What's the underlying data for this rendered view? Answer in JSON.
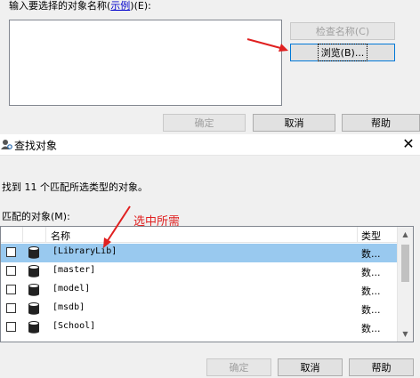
{
  "prev_dialog": {
    "prompt_label": "输入要选择的对象名称(",
    "example_link": "示例",
    "prompt_suffix": ")(E):",
    "check_names_button": "检查名称(C)",
    "browse_button": "浏览(B)...",
    "ok_button": "确定",
    "cancel_button": "取消",
    "help_button": "帮助"
  },
  "find_dialog": {
    "title": "查找对象",
    "found_text": "找到 11 个匹配所选类型的对象。",
    "matched_label": "匹配的对象(M):",
    "columns": {
      "name": "名称",
      "type": "类型"
    },
    "rows": [
      {
        "name": "[LibraryLib]",
        "type": "数...",
        "selected": true
      },
      {
        "name": "[master]",
        "type": "数...",
        "selected": false
      },
      {
        "name": "[model]",
        "type": "数...",
        "selected": false
      },
      {
        "name": "[msdb]",
        "type": "数...",
        "selected": false
      },
      {
        "name": "[School]",
        "type": "数...",
        "selected": false
      }
    ],
    "ok_button": "确定",
    "cancel_button": "取消",
    "help_button": "帮助"
  },
  "annotations": {
    "select_hint": "选中所需"
  },
  "colors": {
    "selection": "#99c9ef",
    "annotation": "#e02020",
    "link": "#0000cc"
  }
}
